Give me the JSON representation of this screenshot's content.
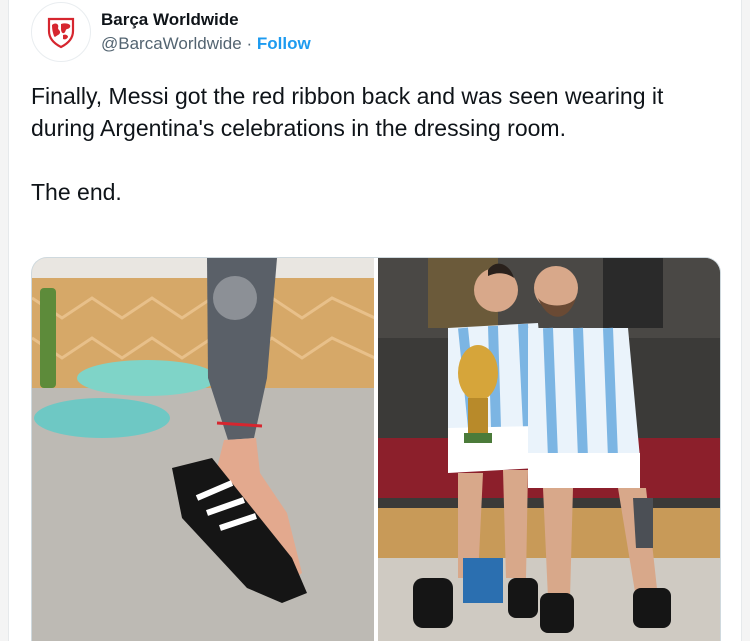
{
  "author": {
    "display_name": "Barça Worldwide",
    "handle": "@BarcaWorldwide",
    "separator": "·",
    "follow_label": "Follow",
    "avatar_icon": "barca-shield-map-icon"
  },
  "tweet": {
    "text": "Finally, Messi got the red ribbon back and was seen wearing it during Argentina's celebrations in the dressing room.",
    "ending": "The end."
  },
  "media": {
    "photos": [
      {
        "subject": "foot-in-slide-sandal-with-red-ribbon"
      },
      {
        "subject": "two-players-with-world-cup-trophy"
      }
    ]
  },
  "colors": {
    "link": "#1d9bf0",
    "text": "#0f1419",
    "secondary": "#536471",
    "brand_red": "#d6262f"
  }
}
